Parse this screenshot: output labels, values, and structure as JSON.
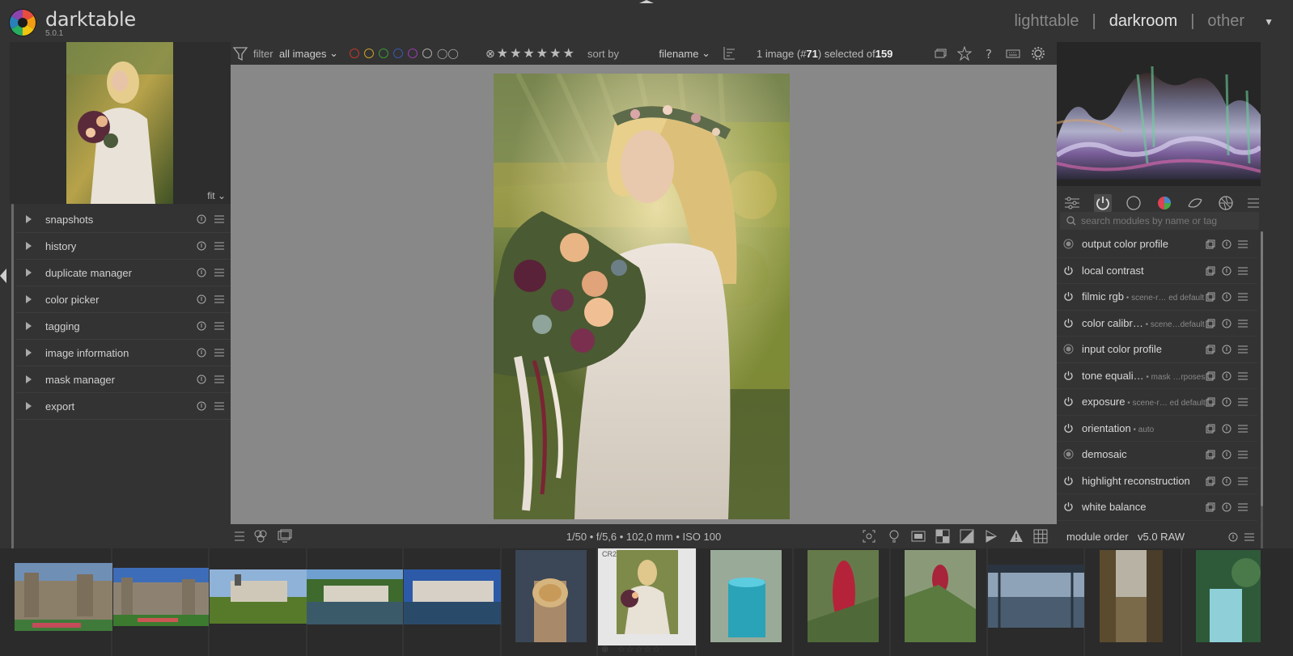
{
  "app": {
    "name": "darktable",
    "version": "5.0.1",
    "views": [
      "lighttable",
      "darkroom",
      "other"
    ],
    "active_view": "darkroom"
  },
  "navigation": {
    "zoom": "fit"
  },
  "left_modules": [
    {
      "label": "snapshots"
    },
    {
      "label": "history"
    },
    {
      "label": "duplicate manager"
    },
    {
      "label": "color picker"
    },
    {
      "label": "tagging"
    },
    {
      "label": "image information"
    },
    {
      "label": "mask manager"
    },
    {
      "label": "export"
    }
  ],
  "toolbar": {
    "filter_label": "filter",
    "filter_value": "all images",
    "sort_label": "sort by",
    "sort_value": "filename",
    "selection_prefix": "1 image (#",
    "selection_id": "71",
    "selection_mid": ") selected of ",
    "selection_total": "159",
    "color_labels": [
      "#c0392b",
      "#c9a227",
      "#3a9a3a",
      "#3b57b0",
      "#9b3bb0"
    ]
  },
  "bottom_bar": {
    "exif": "1/50 • f/5,6 • 102,0 mm • ISO 100"
  },
  "right_panel": {
    "search_placeholder": "search modules by name or tag",
    "modules": [
      {
        "name": "output color profile",
        "sub": "",
        "state": "fixed"
      },
      {
        "name": "local contrast",
        "sub": "",
        "state": "on"
      },
      {
        "name": "filmic rgb",
        "sub": " • scene-r… ed default",
        "state": "on"
      },
      {
        "name": "color calibr…",
        "sub": " • scene…default",
        "state": "on"
      },
      {
        "name": "input color profile",
        "sub": "",
        "state": "fixed"
      },
      {
        "name": "tone equali…",
        "sub": " • mask …rposes",
        "state": "on"
      },
      {
        "name": "exposure",
        "sub": " • scene-r… ed default",
        "state": "on"
      },
      {
        "name": "orientation",
        "sub": " • auto",
        "state": "on"
      },
      {
        "name": "demosaic",
        "sub": "",
        "state": "fixed"
      },
      {
        "name": "highlight reconstruction",
        "sub": "",
        "state": "on"
      },
      {
        "name": "white balance",
        "sub": "",
        "state": "on"
      }
    ],
    "module_order_label": "module order",
    "module_order_value": "v5.0 RAW"
  },
  "filmstrip": {
    "selected_tag": "CR2",
    "stars": "☆☆☆☆☆",
    "reject": "⊗"
  }
}
